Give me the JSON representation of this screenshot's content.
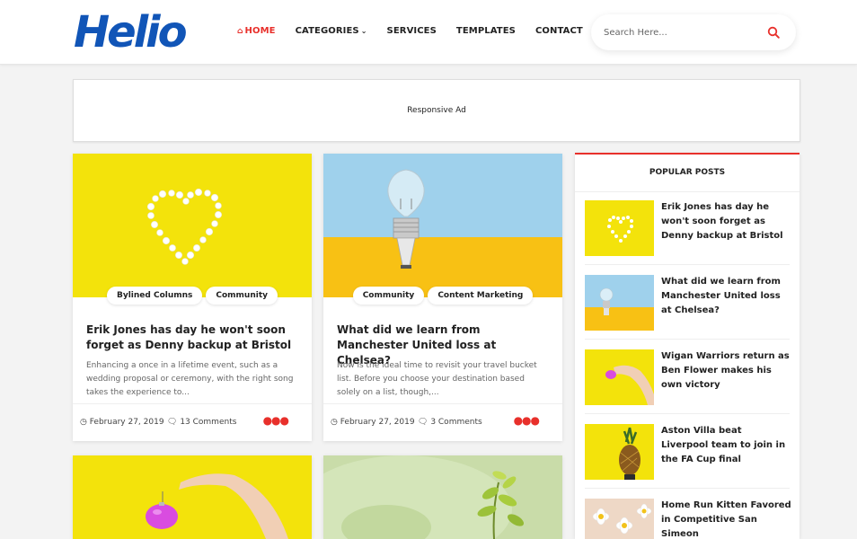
{
  "brand": {
    "logo": "Helio",
    "accent": "#e8302b",
    "logo_color": "#1155b7"
  },
  "nav": {
    "home": "HOME",
    "categories": "CATEGORIES",
    "services": "SERVICES",
    "templates": "TEMPLATES",
    "contact": "CONTACT"
  },
  "search": {
    "placeholder": "Search Here..."
  },
  "ad": {
    "label": "Responsive Ad"
  },
  "posts": [
    {
      "tags": [
        "Bylined Columns",
        "Community"
      ],
      "title": "Erik Jones has day he won't soon forget as Denny backup at Bristol",
      "excerpt": "Enhancing a once  in  a  lifetime event, such as a wedding proposal or ceremony, with the right song takes the experience to...",
      "date": "February 27, 2019",
      "comments": "13 Comments"
    },
    {
      "tags": [
        "Community",
        "Content Marketing"
      ],
      "title": "What did we learn from Manchester United loss at Chelsea?",
      "excerpt": "Now is the ideal time to revisit your travel bucket list. Before you choose your destination based solely on a list, though,...",
      "date": "February 27, 2019",
      "comments": "3 Comments"
    }
  ],
  "sidebar": {
    "heading": "POPULAR POSTS",
    "items": [
      {
        "title": "Erik Jones has day he won't soon forget as Denny backup at Bristol"
      },
      {
        "title": "What did we learn from Manchester United loss at Chelsea?"
      },
      {
        "title": "Wigan Warriors return as Ben Flower makes his own victory"
      },
      {
        "title": "Aston Villa beat Liverpool team to join in the FA Cup final"
      },
      {
        "title": "Home Run Kitten Favored in Competitive San Simeon"
      }
    ]
  },
  "icons": {
    "home": "home-icon",
    "search": "search-icon",
    "clock": "clock-icon",
    "comment": "comment-icon",
    "more": "more-dots-icon"
  }
}
